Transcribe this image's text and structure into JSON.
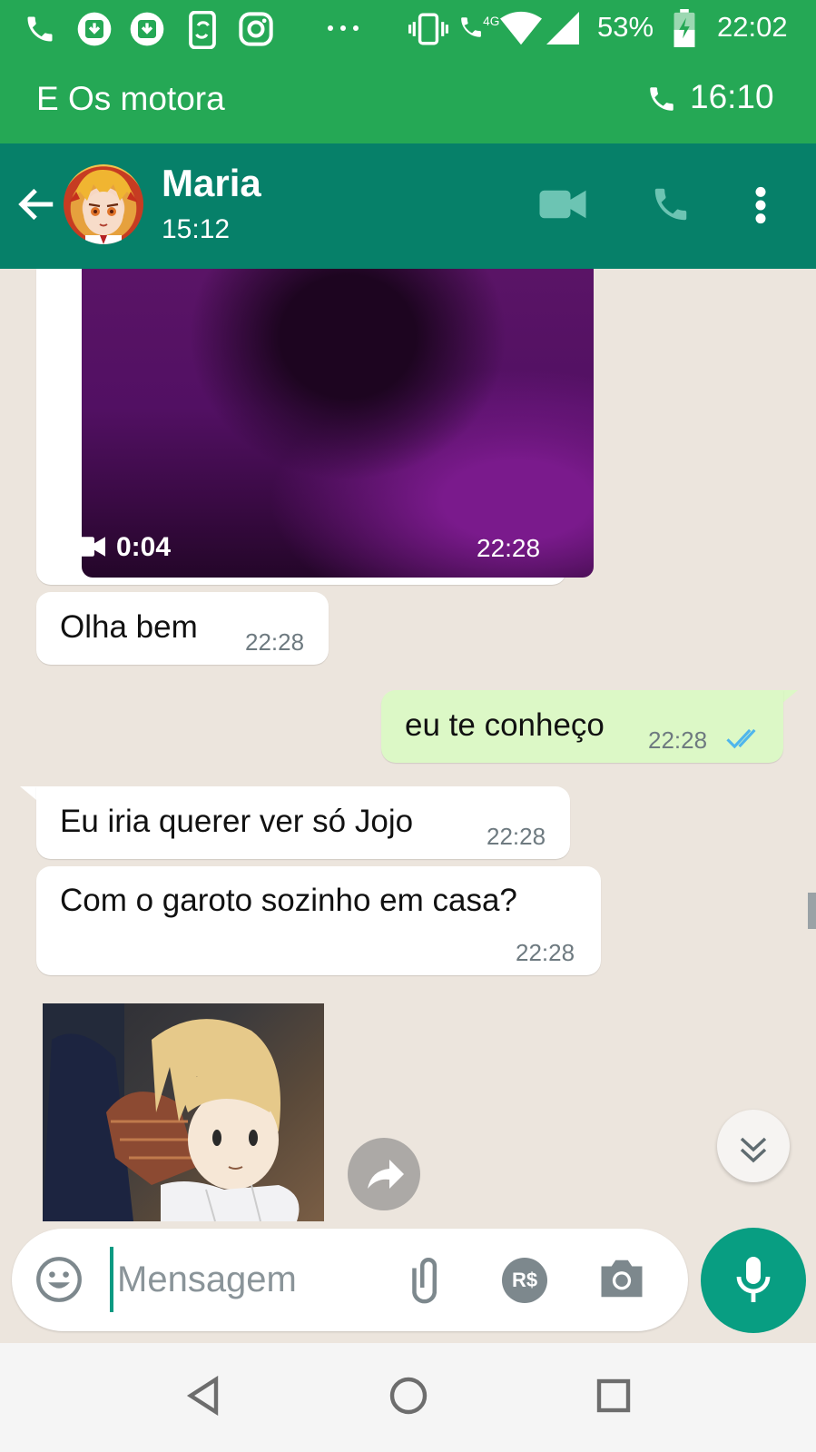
{
  "status_bar": {
    "battery_pct": "53%",
    "time": "22:02",
    "network": "4G",
    "icons": [
      "phone-icon",
      "download-icon",
      "download-icon",
      "phone-sync-icon",
      "instagram-icon",
      "more-dots-icon",
      "vibrate-icon",
      "wifi-call-icon",
      "wifi-icon",
      "signal-icon",
      "battery-icon"
    ]
  },
  "call_banner": {
    "title": "E Os motora",
    "timer": "16:10"
  },
  "header": {
    "name": "Maria",
    "subtitle": "15:12"
  },
  "messages": [
    {
      "type": "video",
      "direction": "in",
      "duration": "0:04",
      "time": "22:28"
    },
    {
      "type": "text",
      "direction": "in",
      "text": "Olha bem",
      "time": "22:28"
    },
    {
      "type": "text",
      "direction": "out",
      "text": "eu te conheço",
      "time": "22:28",
      "status": "read"
    },
    {
      "type": "text",
      "direction": "in",
      "text": "Eu iria querer ver só Jojo",
      "time": "22:28"
    },
    {
      "type": "text",
      "direction": "in",
      "text": "Com o garoto sozinho em casa?",
      "time": "22:28"
    },
    {
      "type": "sticker",
      "direction": "in"
    }
  ],
  "composer": {
    "placeholder": "Mensagem",
    "payment_label": "R$"
  },
  "colors": {
    "status_green": "#25a855",
    "header_teal": "#068069",
    "out_bubble": "#dcf8c6",
    "tick_blue": "#4fb6ec",
    "mic_green": "#089e82"
  }
}
